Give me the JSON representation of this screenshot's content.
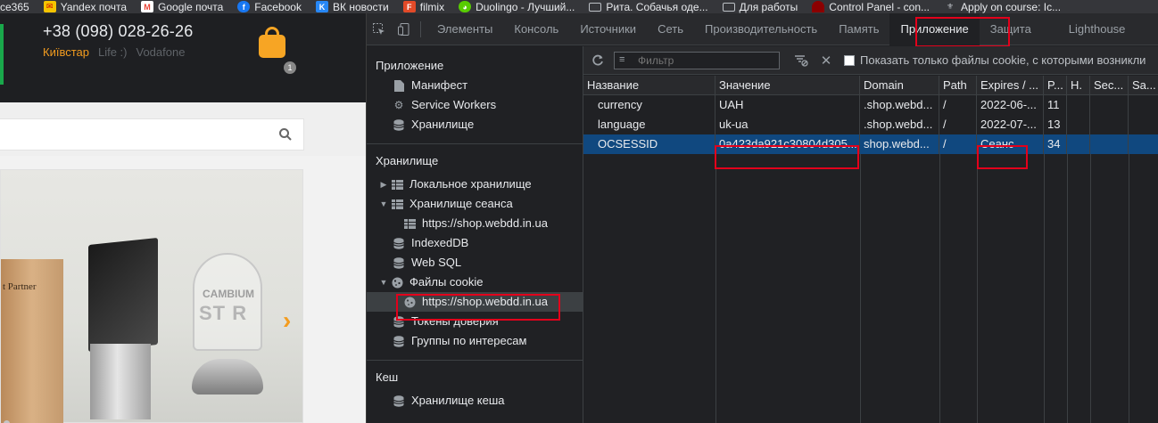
{
  "bookmarks": [
    {
      "label": "ce365",
      "icon": "app-icon",
      "color": "#2b579a"
    },
    {
      "label": "Yandex почта",
      "icon": "mail-icon",
      "color": "#f5c400"
    },
    {
      "label": "Google почта",
      "icon": "gmail-icon",
      "color": "#ea4335"
    },
    {
      "label": "Facebook",
      "icon": "facebook-icon",
      "color": "#1877f2"
    },
    {
      "label": "ВК новости",
      "icon": "vk-icon",
      "color": "#2787f5"
    },
    {
      "label": "filmix",
      "icon": "filmix-icon",
      "color": "#e24a28"
    },
    {
      "label": "Duolingo - Лучший...",
      "icon": "duolingo-icon",
      "color": "#58cc02"
    },
    {
      "label": "Рита. Собачья оде...",
      "icon": "folder-icon",
      "color": "#35363a"
    },
    {
      "label": "Для работы",
      "icon": "folder-icon",
      "color": "#35363a"
    },
    {
      "label": "Control Panel - con...",
      "icon": "control-panel-icon",
      "color": "#c0392b"
    },
    {
      "label": "Apply on course: Ic...",
      "icon": "emblem-icon",
      "color": "#35363a"
    }
  ],
  "page": {
    "phone": "+38 (098) 028-26-26",
    "operators": {
      "active": "Київстар",
      "others": [
        "Life :)",
        "Vodafone"
      ]
    },
    "cart_count": "1",
    "hero_texts": {
      "wood": "t Partner",
      "star_top": "CAMBIUM",
      "star_big": "ST R"
    }
  },
  "devtools": {
    "tabs": [
      {
        "label": "Элементы",
        "active": false
      },
      {
        "label": "Консоль",
        "active": false
      },
      {
        "label": "Источники",
        "active": false
      },
      {
        "label": "Сеть",
        "active": false
      },
      {
        "label": "Производительность",
        "active": false
      },
      {
        "label": "Память",
        "active": false
      },
      {
        "label": "Приложение",
        "active": true
      },
      {
        "label": "Защита",
        "active": false
      },
      {
        "label": "Lighthouse",
        "active": false
      }
    ],
    "sidebar": {
      "section_app": "Приложение",
      "app_items": [
        "Манифест",
        "Service Workers",
        "Хранилище"
      ],
      "section_storage": "Хранилище",
      "storage_items": [
        "Локальное хранилище",
        "Хранилище сеанса",
        "https://shop.webdd.in.ua",
        "IndexedDB",
        "Web SQL",
        "Файлы cookie",
        "https://shop.webdd.in.ua",
        "Токены доверия",
        "Группы по интересам"
      ],
      "section_cache": "Кеш",
      "cache_items": [
        "Хранилище кеша"
      ]
    },
    "toolbar": {
      "filter_placeholder": "Фильтр",
      "checkbox_label": "Показать только файлы cookie, с которыми возникли"
    },
    "table": {
      "columns": [
        "Название",
        "Значение",
        "Domain",
        "Path",
        "Expires / ...",
        "P...",
        "H.",
        "Sec...",
        "Sa..."
      ],
      "rows": [
        [
          "currency",
          "UAH",
          ".shop.webd...",
          "/",
          "2022-06-...",
          "11",
          "",
          "",
          ""
        ],
        [
          "language",
          "uk-ua",
          ".shop.webd...",
          "/",
          "2022-07-...",
          "13",
          "",
          "",
          ""
        ],
        [
          "OCSESSID",
          "0a423da921c30804d305...",
          "shop.webd...",
          "/",
          "Сеанс",
          "34",
          "",
          "",
          ""
        ]
      ],
      "selected_row": 2
    }
  },
  "colors": {
    "accent_orange": "#f39c1f",
    "highlight_red": "#e3001b",
    "selection_blue": "#10487f"
  }
}
